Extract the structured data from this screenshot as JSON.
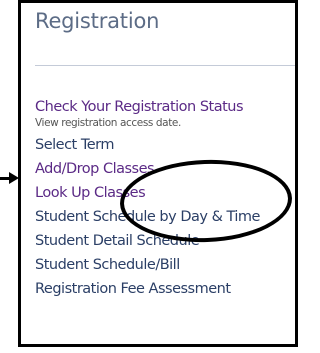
{
  "section": {
    "title": "Registration"
  },
  "menu": {
    "items": [
      {
        "label": "Check Your Registration Status",
        "description": "View registration access date."
      },
      {
        "label": "Select Term"
      },
      {
        "label": "Add/Drop Classes"
      },
      {
        "label": "Look Up Classes"
      },
      {
        "label": "Student Schedule by Day & Time"
      },
      {
        "label": "Student Detail Schedule"
      },
      {
        "label": "Student Schedule/Bill"
      },
      {
        "label": "Registration Fee Assessment"
      }
    ]
  },
  "colors": {
    "title": "#5c6c86",
    "link_visited": "#5b2a86",
    "link": "#2b3f66",
    "annotation": "#000000"
  }
}
